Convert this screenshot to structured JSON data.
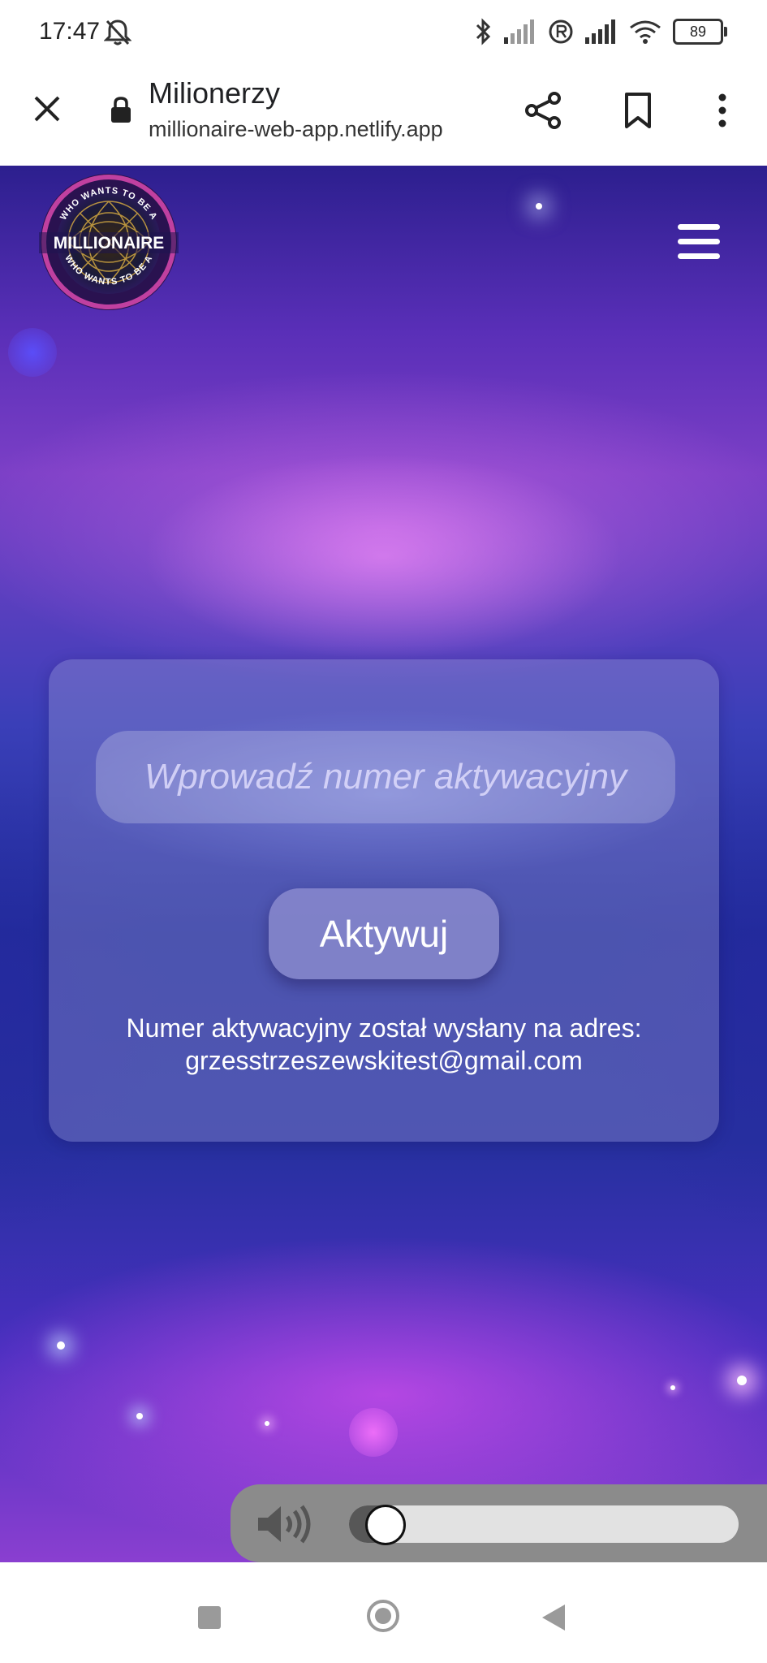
{
  "status_bar": {
    "time": "17:47",
    "battery": "89"
  },
  "browser": {
    "title": "Milionerzy",
    "url": "millionaire-web-app.netlify.app"
  },
  "logo": {
    "top_text": "WHO WANTS TO BE A",
    "main_text": "MILLIONAIRE",
    "bottom_text": "WHO WANTS TO BE A"
  },
  "activation": {
    "input_placeholder": "Wprowadź numer aktywacyjny",
    "input_value": "",
    "button_label": "Aktywuj",
    "info_line1": "Numer aktywacyjny został wysłany na adres:",
    "info_line2": "grzesstrzeszewskitest@gmail.com"
  },
  "audio": {
    "volume_fraction": 0.09
  },
  "colors": {
    "card_bg": "rgba(150,150,210,0.38)",
    "accent": "#ffffff"
  }
}
